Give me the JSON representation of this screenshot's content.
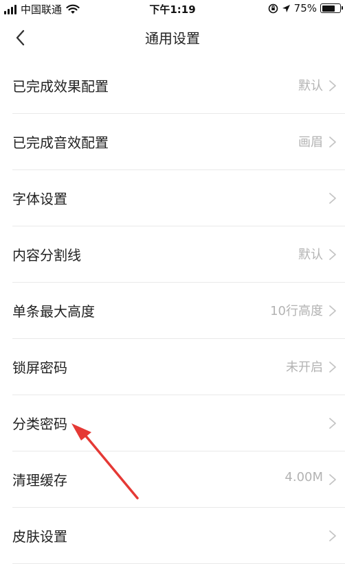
{
  "status_bar": {
    "carrier": "中国联通",
    "time": "下午1:19",
    "battery": "75%",
    "battery_level": 0.75
  },
  "nav": {
    "title": "通用设置",
    "back_icon": "chevron-left-icon"
  },
  "settings": [
    {
      "label": "已完成效果配置",
      "value": "默认"
    },
    {
      "label": "已完成音效配置",
      "value": "画眉"
    },
    {
      "label": "字体设置",
      "value": ""
    },
    {
      "label": "内容分割线",
      "value": "默认"
    },
    {
      "label": "单条最大高度",
      "value": "10行高度"
    },
    {
      "label": "锁屏密码",
      "value": "未开启"
    },
    {
      "label": "分类密码",
      "value": ""
    },
    {
      "label": "清理缓存",
      "value": "4.00M"
    },
    {
      "label": "皮肤设置",
      "value": ""
    }
  ],
  "colors": {
    "annotation_arrow": "#e53935",
    "value_text": "#b3b3b3",
    "divider": "#e9e9e9"
  }
}
